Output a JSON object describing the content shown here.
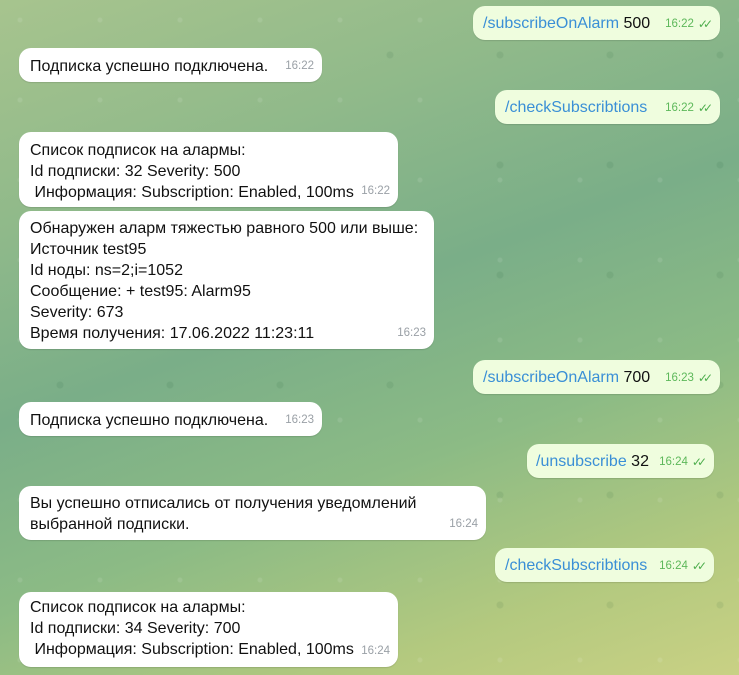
{
  "messages": [
    {
      "dir": "out",
      "cmd": "/subscribeOnAlarm",
      "arg": " 500",
      "time": "16:22"
    },
    {
      "dir": "in",
      "lines": [
        "Подписка успешно подключена."
      ],
      "time": "16:22"
    },
    {
      "dir": "out",
      "cmd": "/checkSubscribtions",
      "arg": "",
      "time": "16:22"
    },
    {
      "dir": "in",
      "lines": [
        "Список подписок на алармы:",
        "Id подписки: 32 Severity: 500",
        " Информация: Subscription: Enabled, 100ms"
      ],
      "time": "16:22"
    },
    {
      "dir": "in",
      "lines": [
        "Обнаружен аларм тяжестью равного 500 или выше:",
        "Источник test95",
        "Id ноды: ns=2;i=1052",
        "Сообщение: + test95: Alarm95",
        "Severity: 673",
        "Время получения: 17.06.2022 11:23:11"
      ],
      "time": "16:23"
    },
    {
      "dir": "out",
      "cmd": "/subscribeOnAlarm",
      "arg": " 700",
      "time": "16:23"
    },
    {
      "dir": "in",
      "lines": [
        "Подписка успешно подключена."
      ],
      "time": "16:23"
    },
    {
      "dir": "out",
      "cmd": "/unsubscribe",
      "arg": " 32",
      "time": "16:24"
    },
    {
      "dir": "in",
      "lines": [
        "Вы успешно отписались от получения уведомлений",
        "выбранной подписки."
      ],
      "time": "16:24"
    },
    {
      "dir": "out",
      "cmd": "/checkSubscribtions",
      "arg": "",
      "time": "16:24"
    },
    {
      "dir": "in",
      "lines": [
        "Список подписок на алармы:",
        "Id подписки: 34 Severity: 700",
        " Информация: Subscription: Enabled, 100ms"
      ],
      "time": "16:24"
    }
  ],
  "colors": {
    "incoming": "#ffffff",
    "outgoing": "#effdde",
    "command": "#3a8fd6",
    "read_check": "#4fae4e"
  },
  "icons": {
    "read": "double-check-icon"
  }
}
